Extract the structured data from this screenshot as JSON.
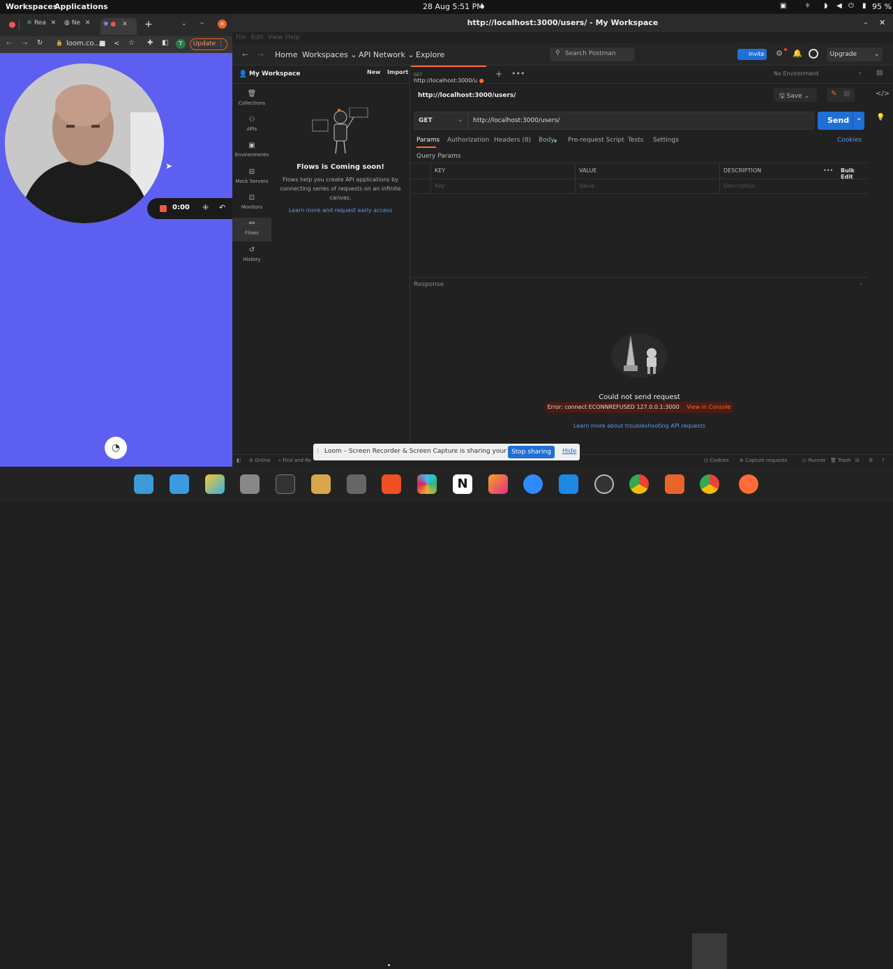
{
  "system_bar": {
    "workspaces": "Workspaces",
    "applications": "Applications",
    "datetime": "28 Aug  5:51 PM",
    "battery": "95 %"
  },
  "chrome": {
    "tabs": [
      "Rea",
      "Ne"
    ],
    "address": "loom.co...",
    "profile_initial": "T",
    "update_label": "Update"
  },
  "loom": {
    "timer": "0:00",
    "share_message": "Loom – Screen Recorder & Screen Capture is sharing your screen.",
    "stop_sharing": "Stop sharing",
    "hide": "Hide"
  },
  "postman": {
    "window_title": "http://localhost:3000/users/ - My Workspace",
    "menu": [
      "File",
      "Edit",
      "View",
      "Help"
    ],
    "nav": {
      "home": "Home",
      "workspaces": "Workspaces",
      "api_network": "API Network",
      "explore": "Explore"
    },
    "search_placeholder": "Search Postman",
    "invite": "Invite",
    "upgrade": "Upgrade",
    "workspace_name": "My Workspace",
    "new_label": "New",
    "import_label": "Import",
    "rail": [
      {
        "label": "Collections",
        "icon": "collections-icon"
      },
      {
        "label": "APIs",
        "icon": "apis-icon"
      },
      {
        "label": "Environments",
        "icon": "environments-icon"
      },
      {
        "label": "Mock Servers",
        "icon": "mock-servers-icon"
      },
      {
        "label": "Monitors",
        "icon": "monitors-icon"
      },
      {
        "label": "Flows",
        "icon": "flows-icon"
      },
      {
        "label": "History",
        "icon": "history-icon"
      }
    ],
    "flows": {
      "title": "Flows is Coming soon!",
      "description": "Flows help you create API applications by connecting series of requests on an infinite canvas.",
      "link": "Learn more and request early access"
    },
    "request_tab": {
      "method": "GET",
      "label": "http://localhost:3000/u"
    },
    "environment": "No Environment",
    "request_name": "http://localhost:3000/users/",
    "save_label": "Save",
    "method": "GET",
    "url": "http://localhost:3000/users/",
    "send_label": "Send",
    "subtabs": [
      "Params",
      "Authorization",
      "Headers (8)",
      "Body",
      "Pre-request Script",
      "Tests",
      "Settings"
    ],
    "cookies_link": "Cookies",
    "query_params_title": "Query Params",
    "table_headers": [
      "KEY",
      "VALUE",
      "DESCRIPTION"
    ],
    "bulk_edit": "Bulk Edit",
    "placeholders": {
      "key": "Key",
      "value": "Value",
      "description": "Description"
    },
    "response_label": "Response",
    "response_error_title": "Could not send request",
    "error_message": "Error: connect ECONNREFUSED 127.0.0.1:3000",
    "view_console": "View in Console",
    "troubleshoot_link": "Learn more about troubleshooting API requests",
    "status_bar": {
      "online": "Online",
      "find_replace": "Find and Re",
      "cookies": "Cookies",
      "capture": "Capture requests",
      "runner": "Runner",
      "trash": "Trash"
    }
  },
  "colors": {
    "postman_orange": "#ff6c37",
    "send_blue": "#1f6fd6",
    "loom_bg": "#5d5ff0"
  }
}
